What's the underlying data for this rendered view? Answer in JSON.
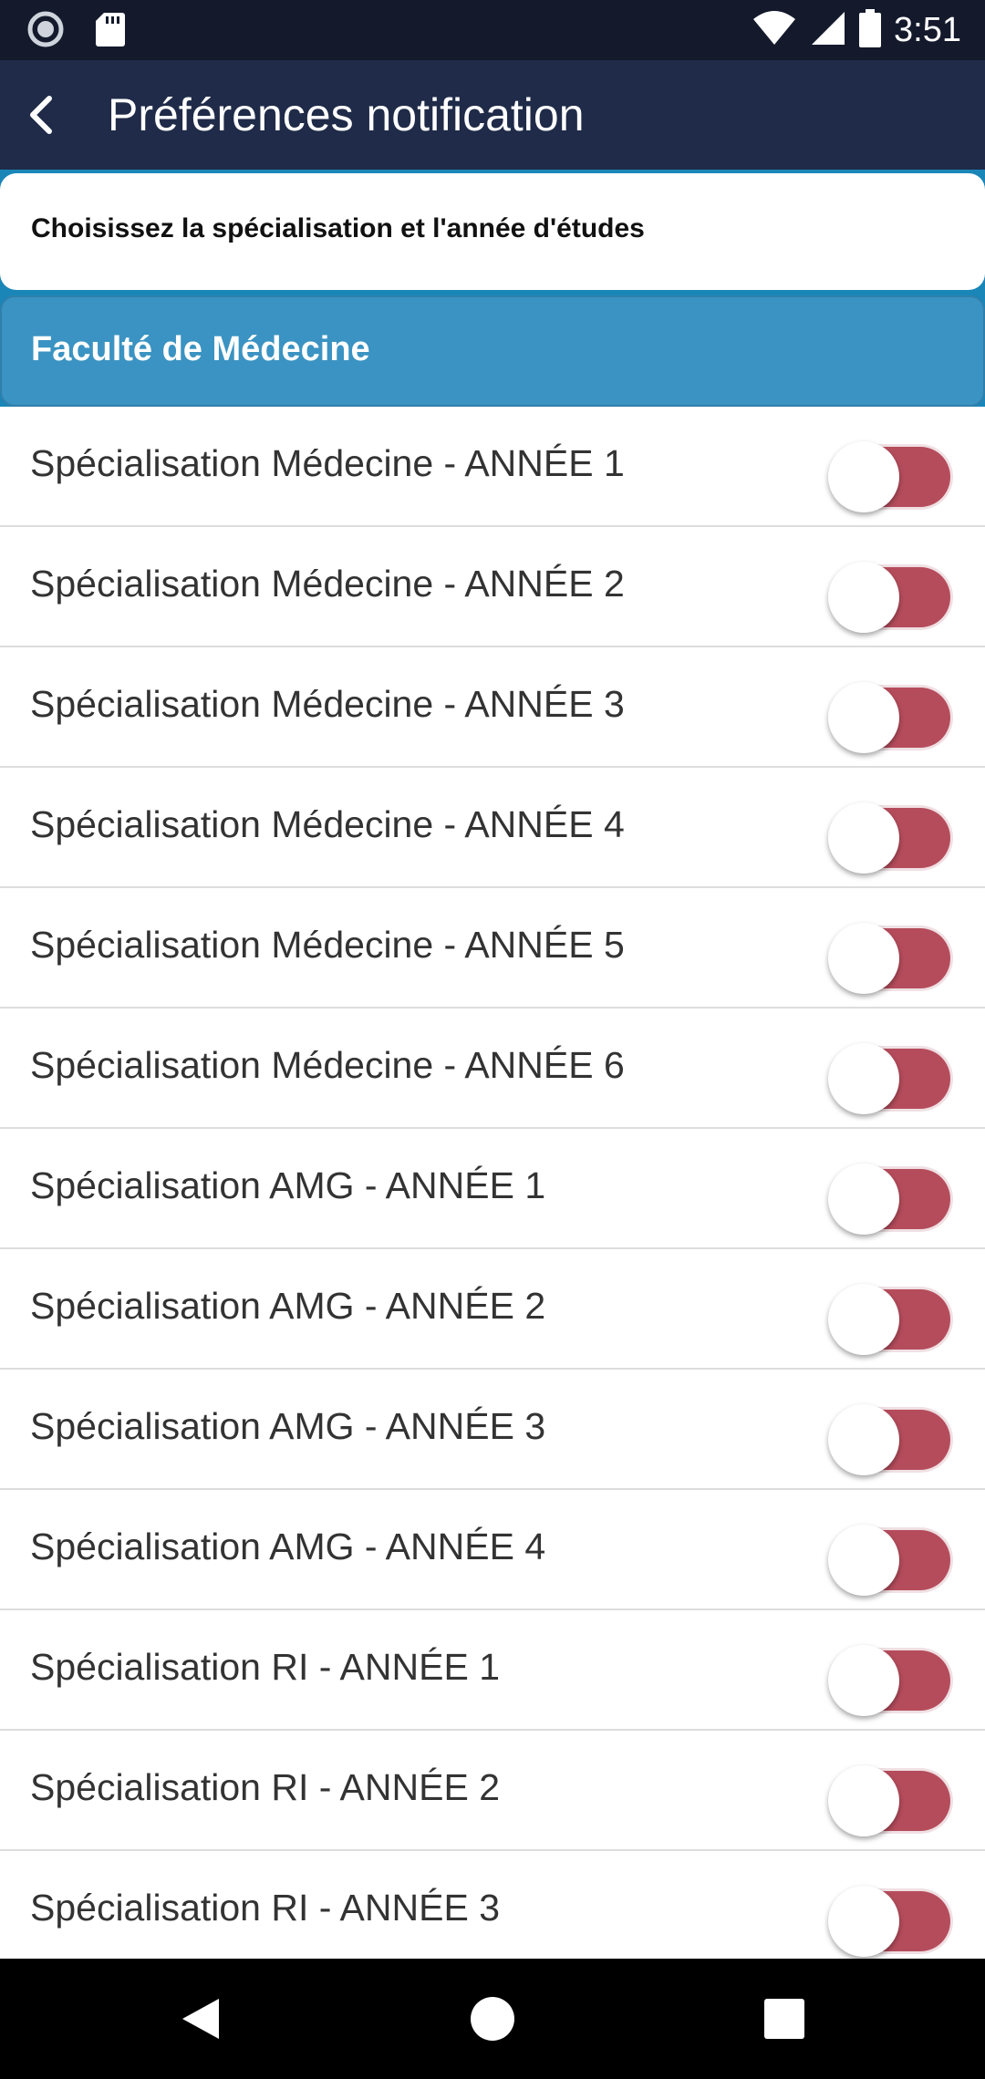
{
  "status_bar": {
    "time": "3:51",
    "icons": [
      "record-icon",
      "sd-card-icon",
      "wifi-icon",
      "signal-icon",
      "battery-icon"
    ]
  },
  "app_bar": {
    "title": "Préférences notification",
    "back_icon": "back-arrow-icon"
  },
  "instruction": "Choisissez la spécialisation et l'année d'études",
  "faculty": "Faculté de Médecine",
  "items": [
    {
      "label": "Spécialisation Médecine - ANNÉE 1",
      "enabled": false
    },
    {
      "label": "Spécialisation Médecine - ANNÉE 2",
      "enabled": false
    },
    {
      "label": "Spécialisation Médecine - ANNÉE 3",
      "enabled": false
    },
    {
      "label": "Spécialisation Médecine - ANNÉE 4",
      "enabled": false
    },
    {
      "label": "Spécialisation Médecine - ANNÉE 5",
      "enabled": false
    },
    {
      "label": "Spécialisation Médecine - ANNÉE 6",
      "enabled": false
    },
    {
      "label": "Spécialisation AMG - ANNÉE 1",
      "enabled": false
    },
    {
      "label": "Spécialisation AMG - ANNÉE 2",
      "enabled": false
    },
    {
      "label": "Spécialisation AMG - ANNÉE 3",
      "enabled": false
    },
    {
      "label": "Spécialisation AMG - ANNÉE 4",
      "enabled": false
    },
    {
      "label": "Spécialisation RI - ANNÉE 1",
      "enabled": false
    },
    {
      "label": "Spécialisation RI - ANNÉE 2",
      "enabled": false
    },
    {
      "label": "Spécialisation RI - ANNÉE 3",
      "enabled": false
    }
  ],
  "colors": {
    "status_bar": "#141a2c",
    "app_bar": "#1f2b48",
    "faculty_header": "#3a93c2",
    "toggle_track": "#b54c5c"
  },
  "nav_bar": {
    "icons": [
      "back-triangle-icon",
      "home-circle-icon",
      "recents-square-icon"
    ]
  }
}
